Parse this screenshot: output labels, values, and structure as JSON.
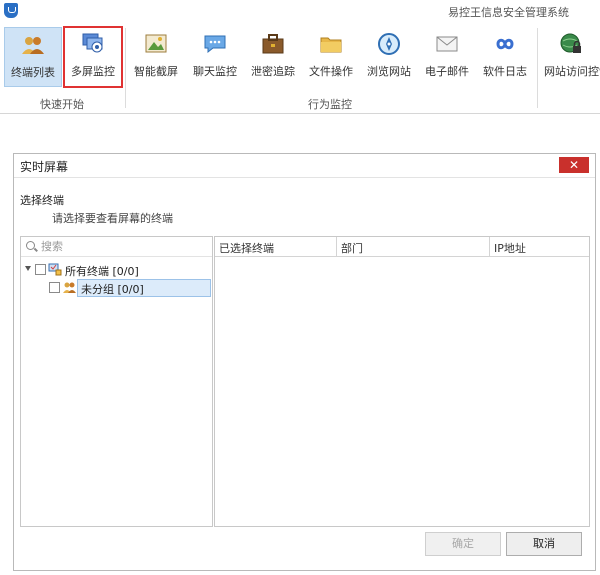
{
  "app": {
    "title": "易控王信息安全管理系统"
  },
  "ribbon": {
    "tools": [
      {
        "label": "终端列表",
        "icon": "users-group-icon"
      },
      {
        "label": "多屏监控",
        "icon": "multi-screen-icon"
      },
      {
        "label": "智能截屏",
        "icon": "picture-icon"
      },
      {
        "label": "聊天监控",
        "icon": "chat-bubble-icon"
      },
      {
        "label": "泄密追踪",
        "icon": "briefcase-icon"
      },
      {
        "label": "文件操作",
        "icon": "folder-icon"
      },
      {
        "label": "浏览网站",
        "icon": "compass-icon"
      },
      {
        "label": "电子邮件",
        "icon": "envelope-icon"
      },
      {
        "label": "软件日志",
        "icon": "infinity-icon"
      },
      {
        "label": "网站访问控制",
        "icon": "globe-lock-icon"
      }
    ],
    "groups": {
      "quick_start": "快速开始",
      "behavior_monitor": "行为监控"
    }
  },
  "dialog": {
    "title": "实时屏幕",
    "close_label": "✕",
    "section_title": "选择终端",
    "section_subtitle": "请选择要查看屏幕的终端",
    "search_placeholder": "搜索",
    "tree": {
      "root_label": "所有终端  [0/0]",
      "child_label": "未分组  [0/0]"
    },
    "columns": [
      "已选择终端",
      "部门",
      "IP地址"
    ],
    "ok_label": "确定",
    "cancel_label": "取消"
  },
  "colors": {
    "active_tool_bg": "#cfe3f6",
    "highlight_border": "#e03232",
    "close_button": "#c9302c",
    "selected_node_bg": "#dcebfa"
  }
}
